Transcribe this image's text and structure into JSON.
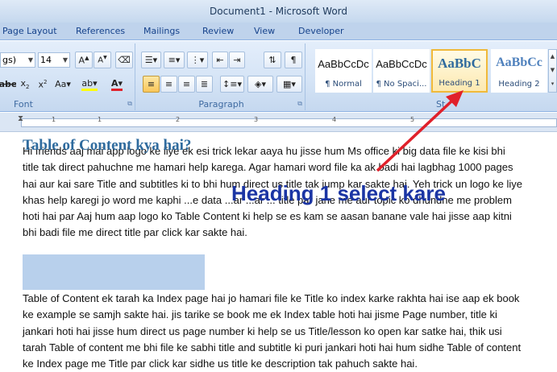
{
  "window": {
    "title": "Document1 - Microsoft Word"
  },
  "tabs": [
    "Page Layout",
    "References",
    "Mailings",
    "Review",
    "View",
    "Developer"
  ],
  "font_group": {
    "font_name": "gs)",
    "font_size": "14",
    "label": "Font"
  },
  "paragraph_group": {
    "label": "Paragraph"
  },
  "styles_group": {
    "label": "St",
    "styles": [
      {
        "preview": "AaBbCcDc",
        "name": "¶ Normal"
      },
      {
        "preview": "AaBbCcDc",
        "name": "¶ No Spaci..."
      },
      {
        "preview": "AaBbC",
        "name": "Heading 1"
      },
      {
        "preview": "AaBbCc",
        "name": "Heading 2"
      }
    ]
  },
  "ruler": {
    "numbers": [
      "1",
      "1",
      "2",
      "3",
      "4",
      "5"
    ]
  },
  "document": {
    "paragraph1": "Hi friends aaj mai app logo ke liye ek esi trick lekar aaya hu jisse hum Ms office ki big data file ke kisi bhi title tak direct pahuchne me hamari help karega. Agar hamari word file ka ak badi hai lagbhag 1000 pages hai aur kai sare Title and subtitles ki to bhi hum direct us title tak jump kar sakte hai. Yeh trick un logo ke liye khas help karegi jo word me kaphi ...e data ...ar ...ar ... title par jane me aur topic ko dhundne me problem hoti hai par Aaj hum aap logo ko Table Content ki help se es kam se aasan banane vale hai jisse aap kitni bhi badi file me direct title par click kar sakte hai.",
    "heading": "Table of Content kya hai?",
    "paragraph2": "Table of Content ek tarah ka Index page hai jo hamari file ke Title ko index karke rakhta hai ise aap ek book ke example se samjh sakte hai. jis tarike se book me ek Index table hoti hai jisme Page number, title ki jankari hoti hai jisse hum direct us page number ki help se us Title/lesson ko open kar satke hai, thik usi tarah Table of content me bhi file ke sabhi title and subtitle ki puri jankari hoti hai hum sidhe Table of content ke Index page me Title par click kar sidhe us title ke description tak pahuch sakte hai."
  },
  "annotation": {
    "text": "Heading 1 select kare",
    "color": "#1b35a4",
    "arrow_color": "#e0202a"
  }
}
